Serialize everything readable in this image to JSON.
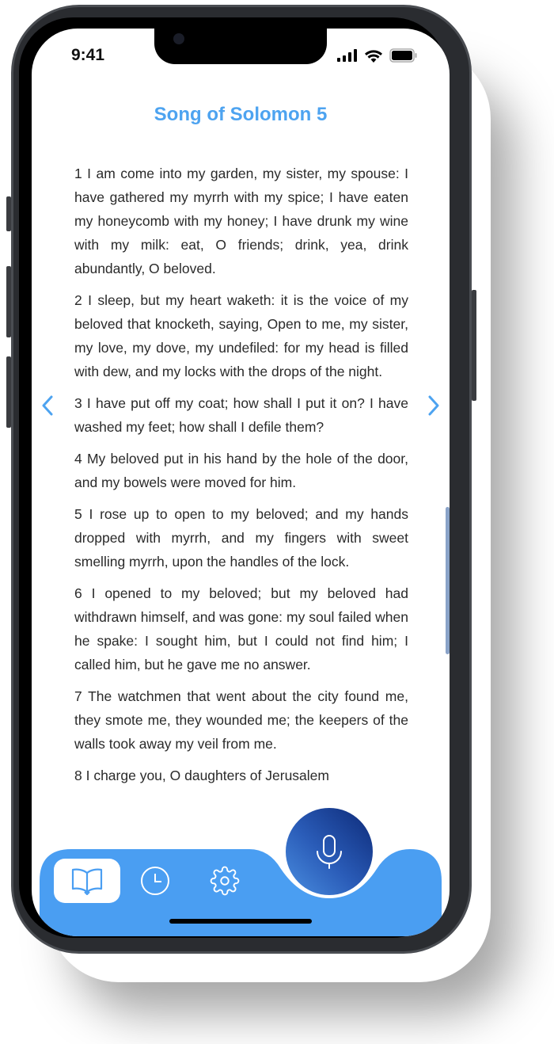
{
  "status_bar": {
    "time": "9:41",
    "icons": [
      "cellular-signal-icon",
      "wifi-icon",
      "battery-icon"
    ]
  },
  "header": {
    "title": "Song of Solomon 5"
  },
  "navigation": {
    "previous": "chevron-left-icon",
    "next": "chevron-right-icon"
  },
  "verses": [
    "1 I am come into my garden, my sister, my spouse: I have gathered my myrrh with my spice; I have eaten my honeycomb with my honey; I have drunk my wine with my milk: eat, O friends; drink, yea, drink abundantly, O beloved.",
    "2 I sleep, but my heart waketh: it is the voice of my beloved that knocketh, saying, Open to me, my sister, my love, my dove, my undefiled: for my head is filled with dew, and my locks with the drops of the night.",
    "3 I have put off my coat; how shall I put it on? I have washed my feet; how shall I defile them?",
    "4 My beloved put in his hand by the hole of the door, and my bowels were moved for him.",
    "5 I rose up to open to my beloved; and my hands dropped with myrrh, and my fingers with sweet smelling myrrh, upon the handles of the lock.",
    "6 I opened to my beloved; but my beloved had withdrawn himself, and was gone: my soul failed when he spake: I sought him, but I could not find him; I called him, but he gave me no answer.",
    "7 The watchmen that went about the city found me, they smote me, they wounded me; the keepers of the walls took away my veil from me.",
    "8 I charge you, O daughters of Jerusalem"
  ],
  "tab_bar": {
    "tabs": [
      {
        "icon": "book-icon",
        "active": true
      },
      {
        "icon": "clock-icon",
        "active": false
      },
      {
        "icon": "gear-icon",
        "active": false
      }
    ],
    "mic_icon": "microphone-icon"
  },
  "colors": {
    "accent": "#4da3f0",
    "tab_bar": "#4a9ef2",
    "mic_dark": "#0d2a78"
  }
}
